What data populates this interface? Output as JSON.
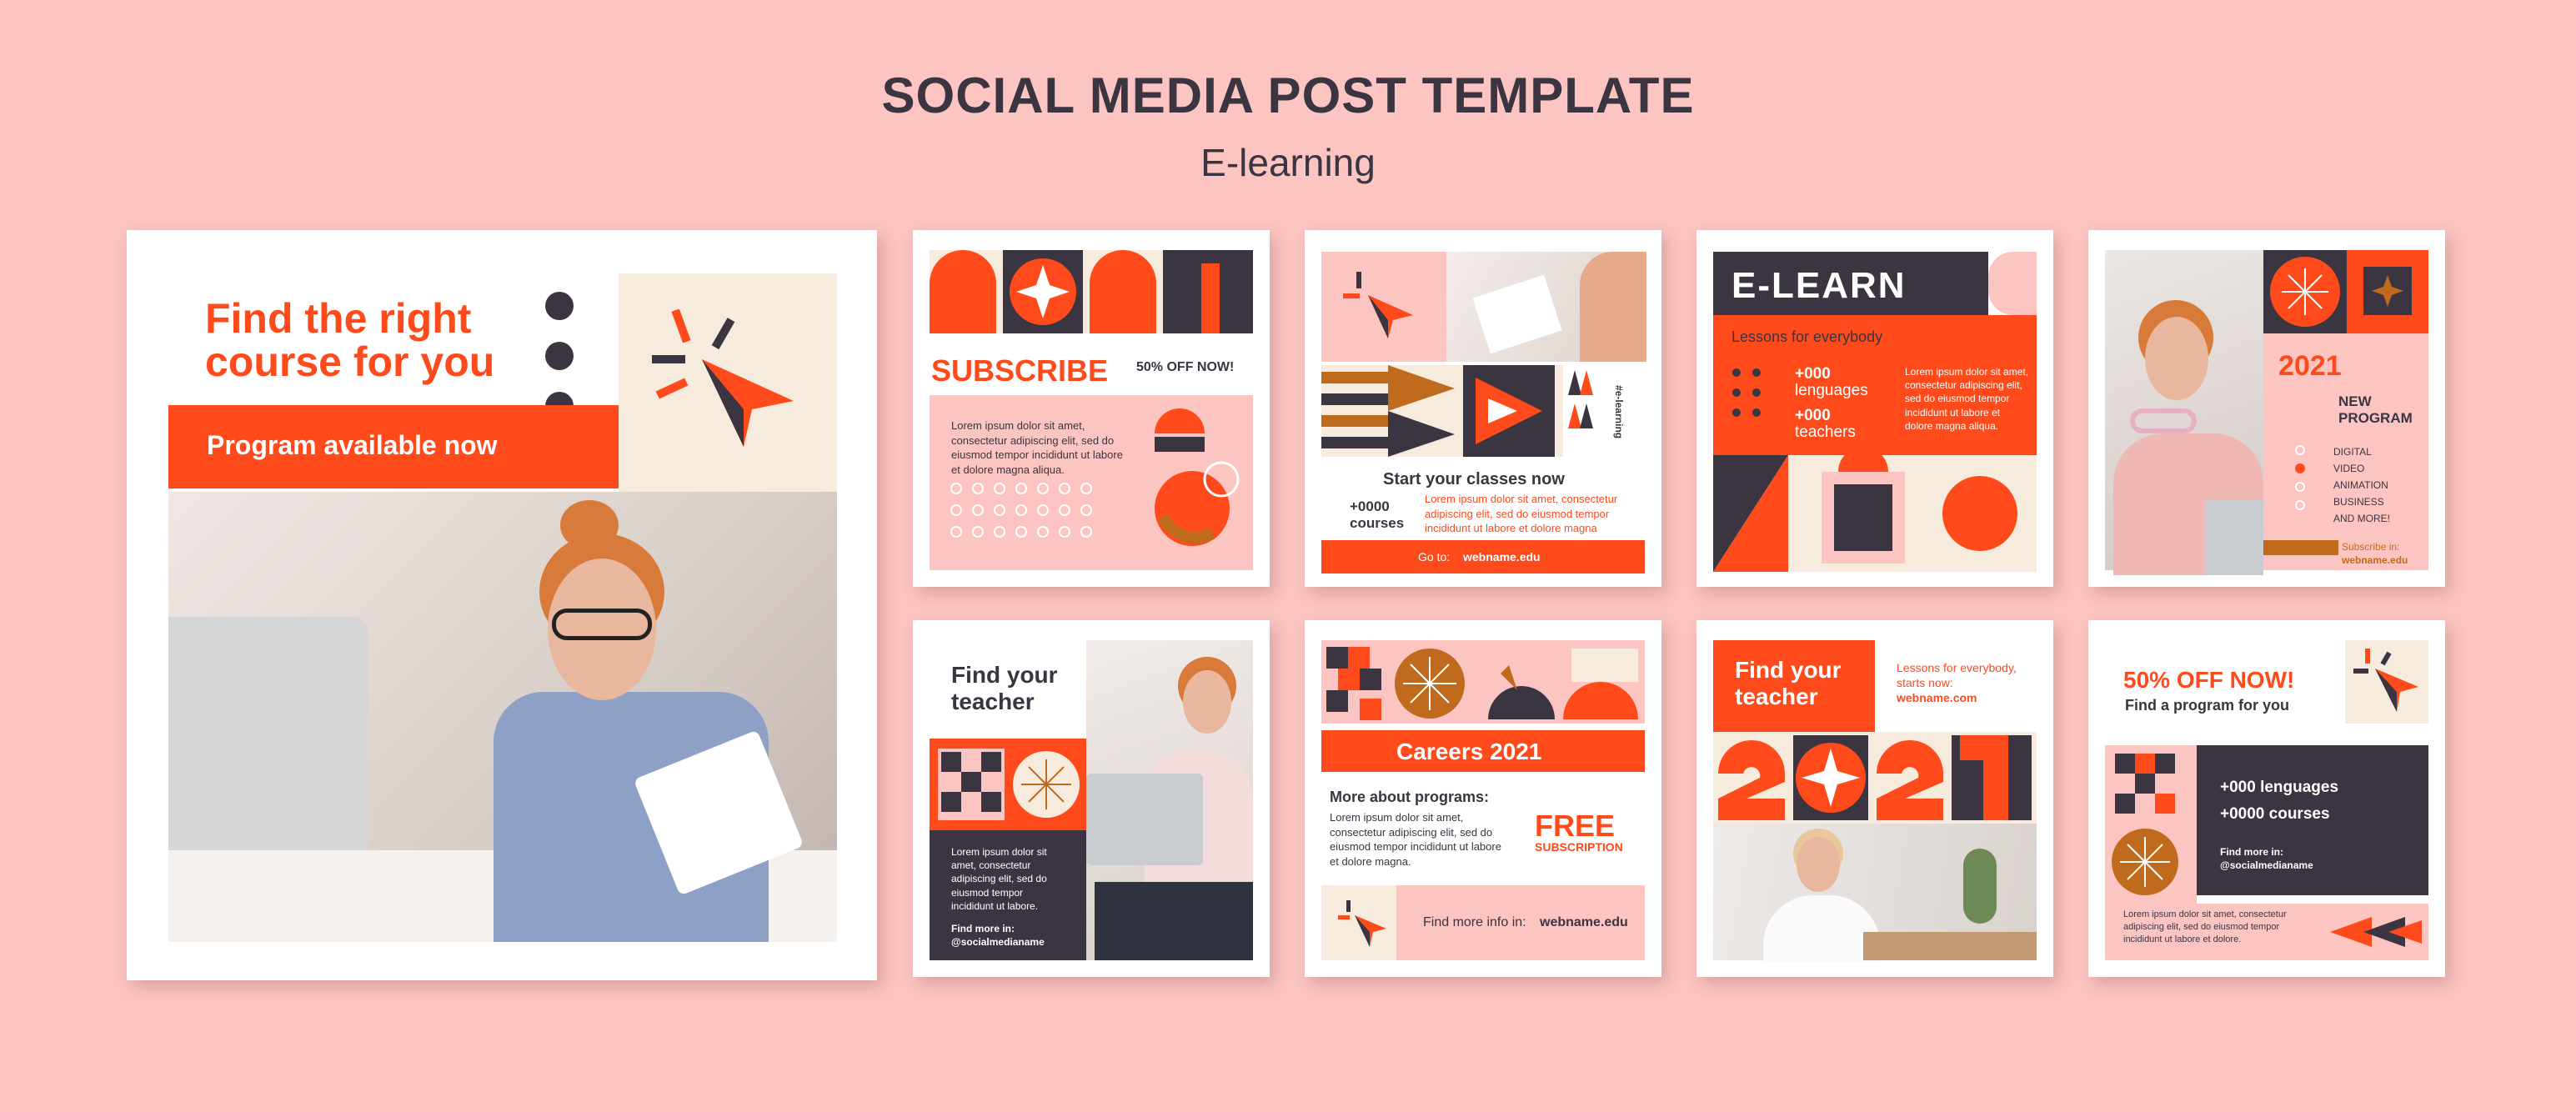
{
  "header": {
    "title": "SOCIAL MEDIA POST TEMPLATE",
    "subtitle": "E-learning"
  },
  "colors": {
    "orange": "#ff4a1c",
    "dark": "#3a3540",
    "pink": "#fcc5c1",
    "cream": "#f7ebdd",
    "bronze": "#c06a1e"
  },
  "post1": {
    "headline1": "Find the right",
    "headline2": "course for you",
    "banner": "Program available now"
  },
  "post2": {
    "subscribe": "SUBSCRIBE",
    "offer": "50% OFF NOW!",
    "body": "Lorem ipsum dolor sit amet, consectetur adipiscing elit, sed do eiusmod tempor incididunt ut labore et dolore magna aliqua."
  },
  "post3": {
    "hashtag": "#e-learning",
    "heading": "Start your classes now",
    "count1": "+0000",
    "count2": "courses",
    "body": "Lorem ipsum dolor sit amet, consectetur adipiscing elit, sed do eiusmod tempor incididunt ut labore et dolore magna",
    "goto_label": "Go to:",
    "goto_url": "webname.edu"
  },
  "post4": {
    "title": "E-LEARN",
    "tagline": "Lessons for everybody",
    "stat1": "+000",
    "stat1b": "lenguages",
    "stat2": "+000",
    "stat2b": "teachers",
    "body": "Lorem ipsum dolor sit amet, consectetur adipiscing elit, sed do eiusmod tempor incididunt ut labore et dolore magna aliqua."
  },
  "post5": {
    "year": "2021",
    "program1": "NEW",
    "program2": "PROGRAM",
    "items": [
      "DIGITAL",
      "VIDEO",
      "ANIMATION",
      "BUSINESS",
      "AND MORE!"
    ],
    "subscribe1": "Subscribe in:",
    "subscribe2": "webname.edu"
  },
  "post6": {
    "heading1": "Find your",
    "heading2": "teacher",
    "body": "Lorem ipsum dolor sit amet, consectetur adipiscing elit, sed do eiusmod tempor incididunt ut labore.",
    "find": "Find more in:",
    "handle": "@socialmedianame"
  },
  "post7": {
    "banner": "Careers 2021",
    "heading": "More about programs:",
    "body": "Lorem ipsum dolor sit amet, consectetur adipiscing elit, sed do eiusmod tempor incididunt ut labore et dolore magna.",
    "free1": "FREE",
    "free2": "SUBSCRIPTION",
    "find_label": "Find more info in:",
    "find_url": "webname.edu"
  },
  "post8": {
    "heading1": "Find your",
    "heading2": "teacher",
    "tag1": "Lessons for everybody,",
    "tag2": "starts now:",
    "url": "webname.com"
  },
  "post9": {
    "offer": "50% OFF NOW!",
    "sub": "Find a program for you",
    "stat1": "+000 lenguages",
    "stat2": "+0000 courses",
    "find": "Find more in:",
    "handle": "@socialmedianame",
    "body": "Lorem ipsum dolor sit amet, consectetur adipiscing elit, sed do eiusmod tempor incididunt ut labore et dolore."
  }
}
